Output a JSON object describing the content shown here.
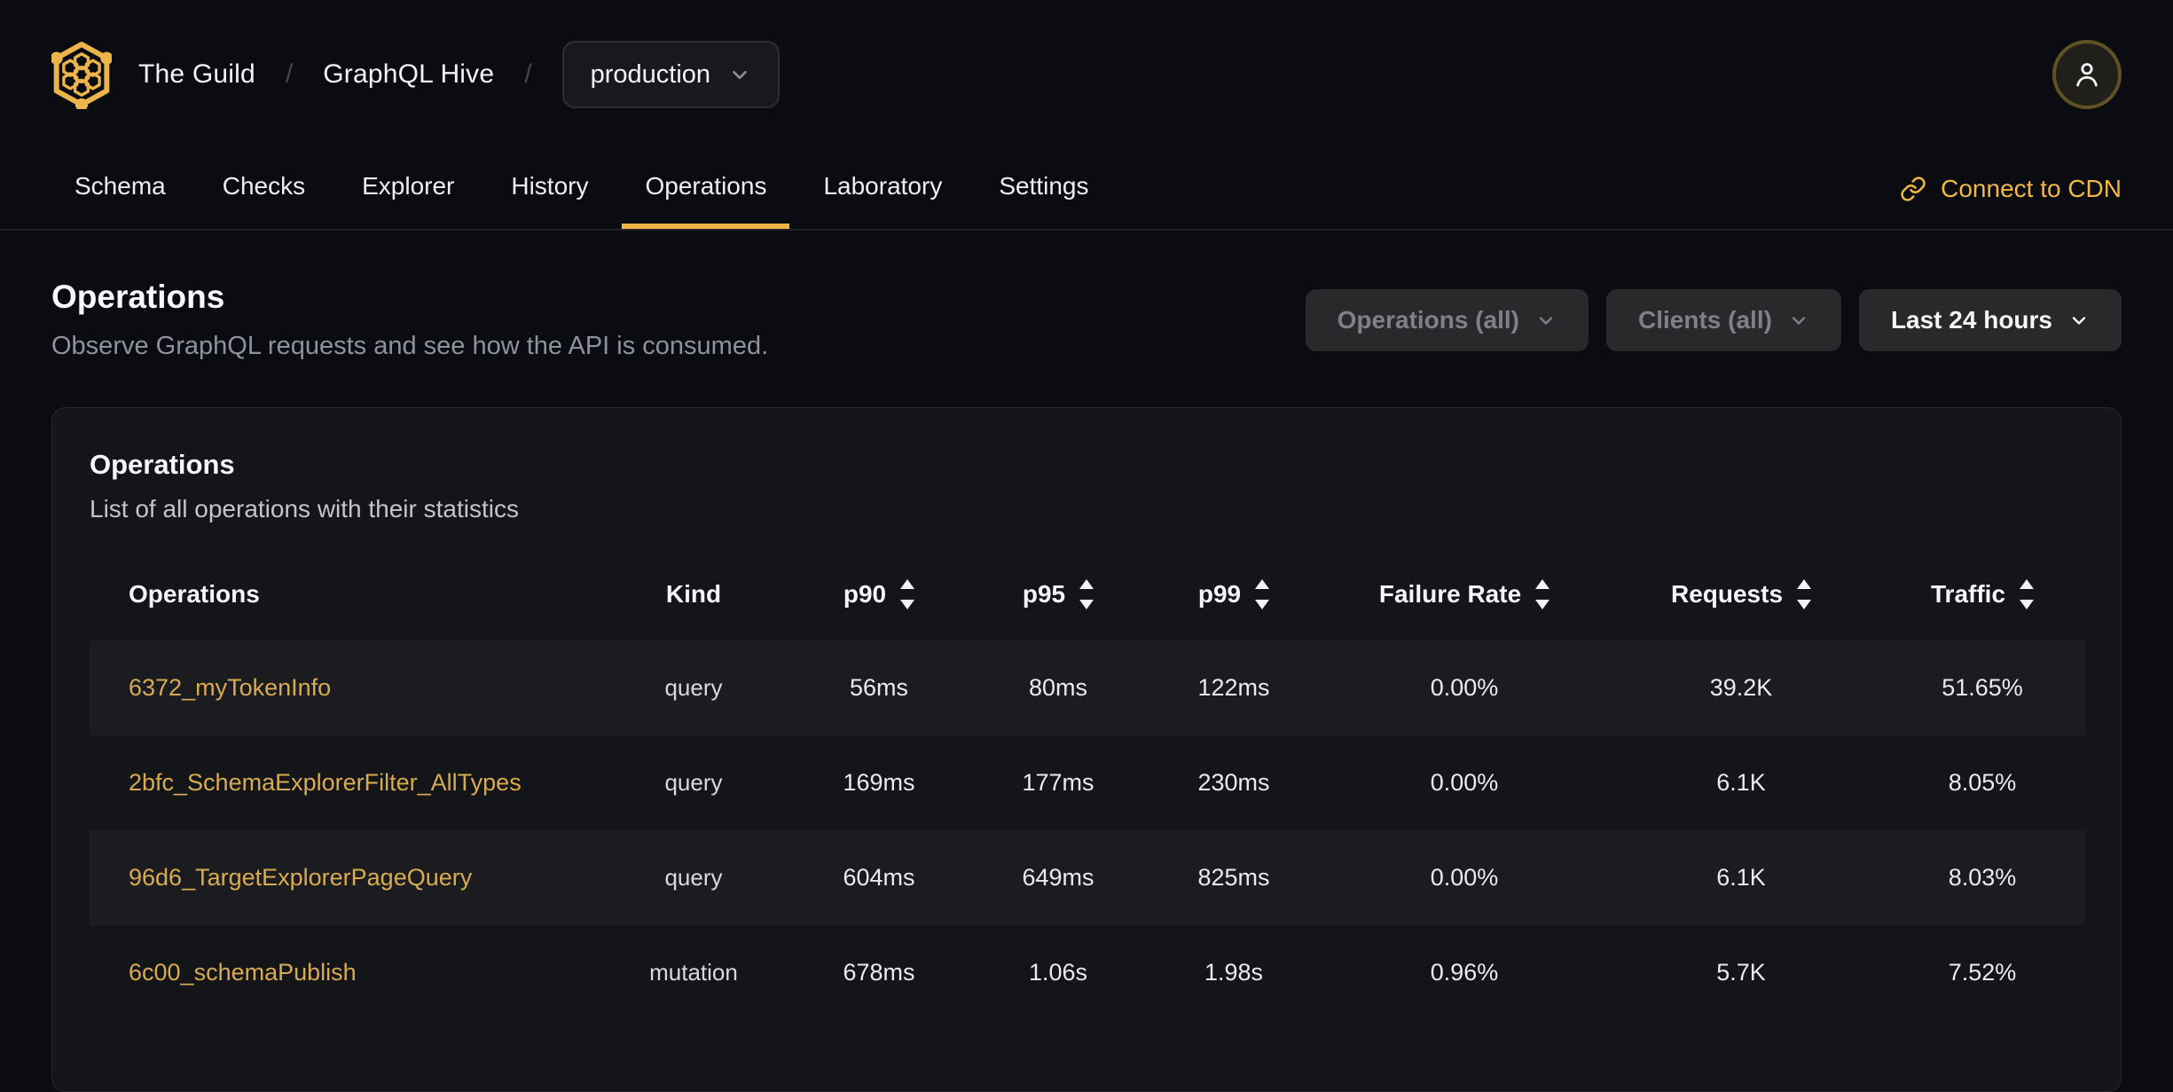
{
  "header": {
    "org": "The Guild",
    "project": "GraphQL Hive",
    "separator": "/",
    "target_selector": {
      "value": "production"
    },
    "icons": {
      "logo": "hive-honeycomb-logo",
      "chevron": "chevron-down-icon",
      "avatar": "user-icon"
    }
  },
  "nav": {
    "tabs": [
      {
        "label": "Schema",
        "active": false
      },
      {
        "label": "Checks",
        "active": false
      },
      {
        "label": "Explorer",
        "active": false
      },
      {
        "label": "History",
        "active": false
      },
      {
        "label": "Operations",
        "active": true
      },
      {
        "label": "Laboratory",
        "active": false
      },
      {
        "label": "Settings",
        "active": false
      }
    ],
    "cdn_link": {
      "label": "Connect to CDN",
      "icon": "link-icon"
    }
  },
  "page": {
    "title": "Operations",
    "subtitle": "Observe GraphQL requests and see how the API is consumed."
  },
  "filters": {
    "operations": {
      "label": "Operations (all)",
      "icon": "chevron-down-icon"
    },
    "clients": {
      "label": "Clients (all)",
      "icon": "chevron-down-icon"
    },
    "period": {
      "label": "Last 24 hours",
      "icon": "chevron-down-icon"
    }
  },
  "card": {
    "title": "Operations",
    "subtitle": "List of all operations with their statistics",
    "table": {
      "columns": [
        {
          "label": "Operations",
          "sortable": false
        },
        {
          "label": "Kind",
          "sortable": false
        },
        {
          "label": "p90",
          "sortable": true
        },
        {
          "label": "p95",
          "sortable": true
        },
        {
          "label": "p99",
          "sortable": true
        },
        {
          "label": "Failure Rate",
          "sortable": true
        },
        {
          "label": "Requests",
          "sortable": true
        },
        {
          "label": "Traffic",
          "sortable": true
        }
      ],
      "rows": [
        {
          "name": "6372_myTokenInfo",
          "kind": "query",
          "p90": "56ms",
          "p95": "80ms",
          "p99": "122ms",
          "failure_rate": "0.00%",
          "requests": "39.2K",
          "traffic": "51.65%"
        },
        {
          "name": "2bfc_SchemaExplorerFilter_AllTypes",
          "kind": "query",
          "p90": "169ms",
          "p95": "177ms",
          "p99": "230ms",
          "failure_rate": "0.00%",
          "requests": "6.1K",
          "traffic": "8.05%"
        },
        {
          "name": "96d6_TargetExplorerPageQuery",
          "kind": "query",
          "p90": "604ms",
          "p95": "649ms",
          "p99": "825ms",
          "failure_rate": "0.00%",
          "requests": "6.1K",
          "traffic": "8.03%"
        },
        {
          "name": "6c00_schemaPublish",
          "kind": "mutation",
          "p90": "678ms",
          "p95": "1.06s",
          "p99": "1.98s",
          "failure_rate": "0.96%",
          "requests": "5.7K",
          "traffic": "7.52%"
        }
      ]
    }
  },
  "colors": {
    "accent_gold": "#efb445",
    "link_gold": "#d9ab51",
    "page_background": "#0a0c11",
    "card_background": "#141519",
    "row_stripe": "#1b1c20"
  }
}
